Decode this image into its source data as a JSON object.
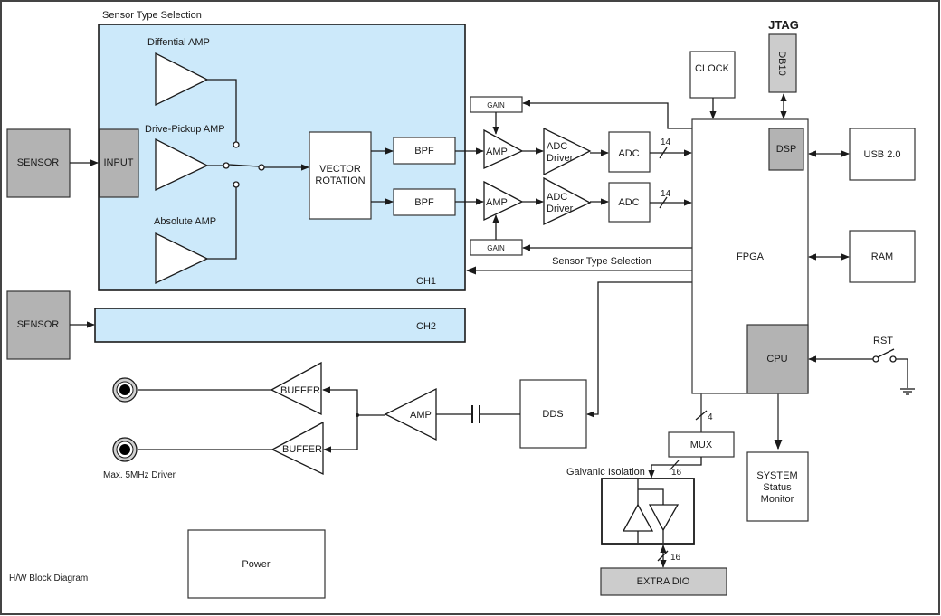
{
  "diagram": {
    "title": "H/W Block Diagram",
    "ch1": {
      "group_label": "Sensor Type Selection",
      "channel_label": "CH1",
      "input_label": "INPUT",
      "amps": [
        "Diffential AMP",
        "Drive-Pickup AMP",
        "Absolute AMP"
      ],
      "vector_rotation": [
        "VECTOR",
        "ROTATION"
      ],
      "bpf": [
        "BPF",
        "BPF"
      ]
    },
    "ch2": {
      "channel_label": "CH2"
    },
    "sensors": [
      "SENSOR",
      "SENSOR"
    ],
    "signal_chain": {
      "gain": [
        "GAIN",
        "GAIN"
      ],
      "amp": [
        "AMP",
        "AMP"
      ],
      "adc_driver": [
        [
          "ADC",
          "Driver"
        ],
        [
          "ADC",
          "Driver"
        ]
      ],
      "adc": [
        "ADC",
        "ADC"
      ],
      "bus_width": [
        "14",
        "14"
      ],
      "sensor_type_selection": "Sensor Type Selection"
    },
    "fpga": {
      "label": "FPGA",
      "dsp": "DSP",
      "cpu": "CPU"
    },
    "clock": "CLOCK",
    "jtag": {
      "title": "JTAG",
      "connector": "DB10"
    },
    "usb": "USB 2.0",
    "ram": "RAM",
    "rst": "RST",
    "system_monitor": [
      "SYSTEM",
      "Status",
      "Monitor"
    ],
    "mux": {
      "label": "MUX",
      "bus_in": "4",
      "bus_out": "16"
    },
    "galvanic": {
      "label": "Galvanic Isolation",
      "bus": "16"
    },
    "extra_dio": "EXTRA DIO",
    "dds": "DDS",
    "output_amp": "AMP",
    "buffers": [
      "BUFFER",
      "BUFFER"
    ],
    "driver_label": "Max. 5MHz Driver",
    "power": "Power",
    "colors": {
      "channel_fill": "#cce9fa",
      "dark_block": "#b3b3b3",
      "light_block": "#cccccc",
      "line": "#1a1a1a"
    }
  }
}
